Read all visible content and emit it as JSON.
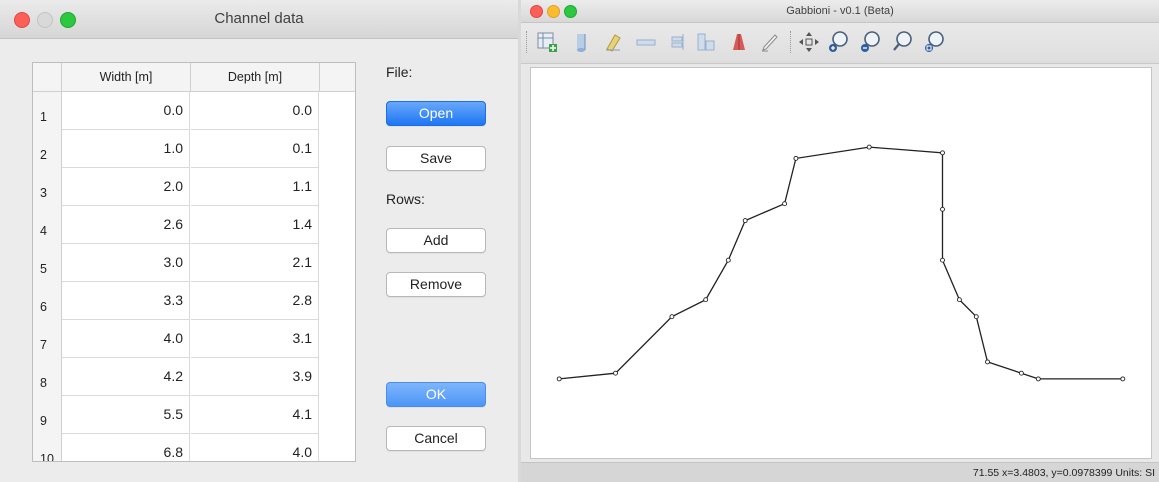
{
  "channel_window": {
    "title": "Channel data",
    "table": {
      "headers": [
        "Width [m]",
        "Depth [m]"
      ],
      "rows": [
        {
          "num": "1",
          "width": "0.0",
          "depth": "0.0"
        },
        {
          "num": "2",
          "width": "1.0",
          "depth": "0.1"
        },
        {
          "num": "3",
          "width": "2.0",
          "depth": "1.1"
        },
        {
          "num": "4",
          "width": "2.6",
          "depth": "1.4"
        },
        {
          "num": "5",
          "width": "3.0",
          "depth": "2.1"
        },
        {
          "num": "6",
          "width": "3.3",
          "depth": "2.8"
        },
        {
          "num": "7",
          "width": "4.0",
          "depth": "3.1"
        },
        {
          "num": "8",
          "width": "4.2",
          "depth": "3.9"
        },
        {
          "num": "9",
          "width": "5.5",
          "depth": "4.1"
        },
        {
          "num": "10",
          "width": "6.8",
          "depth": "4.0"
        }
      ]
    },
    "file_label": "File:",
    "rows_label": "Rows:",
    "buttons": {
      "open": "Open",
      "save": "Save",
      "add": "Add",
      "remove": "Remove",
      "ok": "OK",
      "cancel": "Cancel"
    }
  },
  "plot_window": {
    "title": "Gabbioni - v0.1 (Beta)",
    "toolbar_icons": [
      "add-table-icon",
      "cylinder-icon",
      "clear-icon",
      "flat-bar-icon",
      "align-icon",
      "columns-icon",
      "section-icon",
      "edit-icon",
      "pan-icon",
      "zoom-in-icon",
      "zoom-out-icon",
      "zoom-reset-icon",
      "zoom-fit-icon"
    ],
    "status": "71.55  x=3.4803, y=0.0978399  Units: SI"
  },
  "colors": {
    "accent_blue": "#1d76f4",
    "line": "#222222",
    "close_red": "#fc5f57",
    "max_green": "#2bc840"
  },
  "chart_data": {
    "type": "line",
    "title": "",
    "xlabel": "",
    "ylabel": "",
    "grid": false,
    "x": [
      0.0,
      1.0,
      2.0,
      2.6,
      3.0,
      3.3,
      4.0,
      4.2,
      5.5,
      6.8,
      6.8,
      6.8,
      7.1,
      7.4,
      7.6,
      8.2,
      8.5,
      10.0
    ],
    "y": [
      0.0,
      0.1,
      1.1,
      1.4,
      2.1,
      2.8,
      3.1,
      3.9,
      4.1,
      4.0,
      3.0,
      2.1,
      1.4,
      1.1,
      0.3,
      0.1,
      0.0,
      0.0
    ],
    "xlim": [
      -0.5,
      10.5
    ],
    "ylim": [
      5.5,
      -1.4
    ]
  }
}
